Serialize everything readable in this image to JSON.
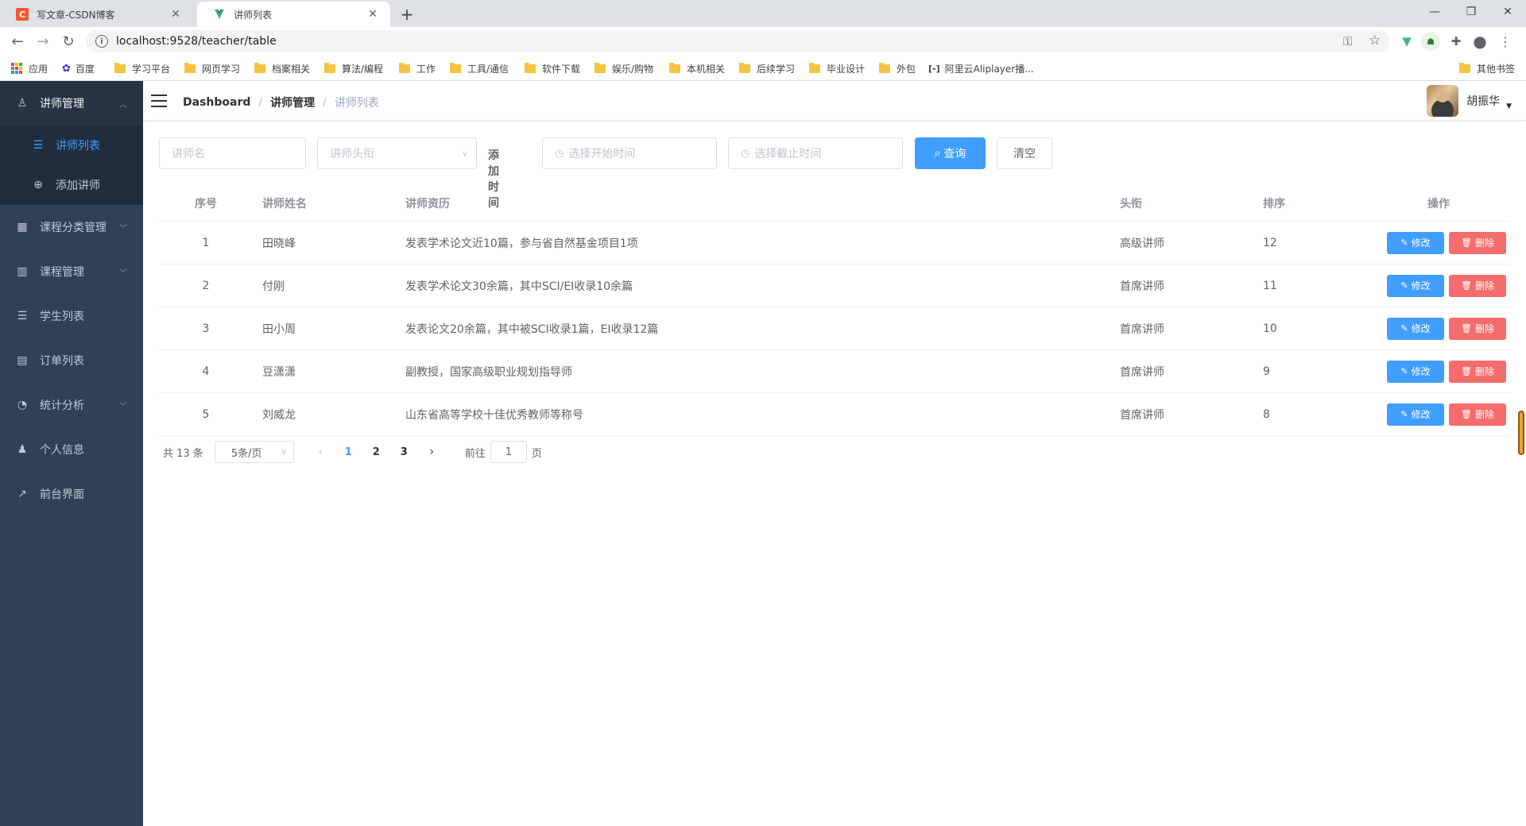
{
  "browser": {
    "tabs": [
      {
        "title": "写文章-CSDN博客",
        "favicon": "C",
        "close": "✕"
      },
      {
        "title": "讲师列表",
        "close": "✕"
      }
    ],
    "new_tab": "+",
    "window_controls": {
      "minimize": "—",
      "restore": "❐",
      "close": "✕"
    },
    "url": "localhost:9528/teacher/table",
    "bookmarks": [
      {
        "label": "应用",
        "icon": "apps-grid-icon"
      },
      {
        "label": "百度",
        "icon": "baidu-paw-icon"
      },
      {
        "label": "学习平台",
        "icon": "folder-icon"
      },
      {
        "label": "网页学习",
        "icon": "folder-icon"
      },
      {
        "label": "档案相关",
        "icon": "folder-icon"
      },
      {
        "label": "算法/编程",
        "icon": "folder-icon"
      },
      {
        "label": "工作",
        "icon": "folder-icon"
      },
      {
        "label": "工具/通信",
        "icon": "folder-icon"
      },
      {
        "label": "软件下载",
        "icon": "folder-icon"
      },
      {
        "label": "娱乐/购物",
        "icon": "folder-icon"
      },
      {
        "label": "本机相关",
        "icon": "folder-icon"
      },
      {
        "label": "后续学习",
        "icon": "folder-icon"
      },
      {
        "label": "毕业设计",
        "icon": "folder-icon"
      },
      {
        "label": "外包",
        "icon": "folder-icon"
      },
      {
        "label": "阿里云Aliplayer播...",
        "icon": "aliyun-icon"
      }
    ],
    "other_bookmarks": "其他书签"
  },
  "sidebar": {
    "groups": [
      {
        "label": "讲师管理",
        "icon": "user-icon",
        "open": true,
        "children": [
          {
            "label": "讲师列表",
            "icon": "list-icon",
            "active": true
          },
          {
            "label": "添加讲师",
            "icon": "plus-circle-icon",
            "active": false
          }
        ]
      },
      {
        "label": "课程分类管理",
        "icon": "grid-icon",
        "has_children": true
      },
      {
        "label": "课程管理",
        "icon": "book-icon",
        "has_children": true
      },
      {
        "label": "学生列表",
        "icon": "list-icon",
        "has_children": false
      },
      {
        "label": "订单列表",
        "icon": "document-icon",
        "has_children": false
      },
      {
        "label": "统计分析",
        "icon": "pie-chart-icon",
        "has_children": true
      },
      {
        "label": "个人信息",
        "icon": "person-icon",
        "has_children": false
      },
      {
        "label": "前台界面",
        "icon": "external-link-icon",
        "has_children": false
      }
    ]
  },
  "header": {
    "breadcrumb": [
      "Dashboard",
      "讲师管理",
      "讲师列表"
    ],
    "breadcrumb_sep": "/",
    "username": "胡振华"
  },
  "search": {
    "name_placeholder": "讲师名",
    "title_placeholder": "讲师头衔",
    "time_label": "添加时间",
    "start_placeholder": "选择开始时间",
    "end_placeholder": "选择截止时间",
    "query_label": "查询",
    "clear_label": "清空"
  },
  "table": {
    "columns": [
      "序号",
      "讲师姓名",
      "讲师资历",
      "头衔",
      "排序",
      "操作"
    ],
    "edit_label": "修改",
    "delete_label": "删除",
    "rows": [
      {
        "index": "1",
        "name": "田晓峰",
        "intro": "发表学术论文近10篇，参与省自然基金项目1项",
        "title": "高级讲师",
        "sort": "12"
      },
      {
        "index": "2",
        "name": "付刚",
        "intro": "发表学术论文30余篇，其中SCI/EI收录10余篇",
        "title": "首席讲师",
        "sort": "11"
      },
      {
        "index": "3",
        "name": "田小周",
        "intro": "发表论文20余篇，其中被SCI收录1篇，EI收录12篇",
        "title": "首席讲师",
        "sort": "10"
      },
      {
        "index": "4",
        "name": "豆潇潇",
        "intro": "副教授，国家高级职业规划指导师",
        "title": "首席讲师",
        "sort": "9"
      },
      {
        "index": "5",
        "name": "刘威龙",
        "intro": "山东省高等学校十佳优秀教师等称号",
        "title": "首席讲师",
        "sort": "8"
      }
    ]
  },
  "pagination": {
    "total_text": "共 13 条",
    "page_size": "5条/页",
    "pages": [
      "1",
      "2",
      "3"
    ],
    "current_page": "1",
    "goto_prefix": "前往",
    "goto_value": "1",
    "goto_suffix": "页"
  },
  "colors": {
    "sidebar_bg": "#304156",
    "primary": "#409eff",
    "danger": "#f56c6c"
  }
}
